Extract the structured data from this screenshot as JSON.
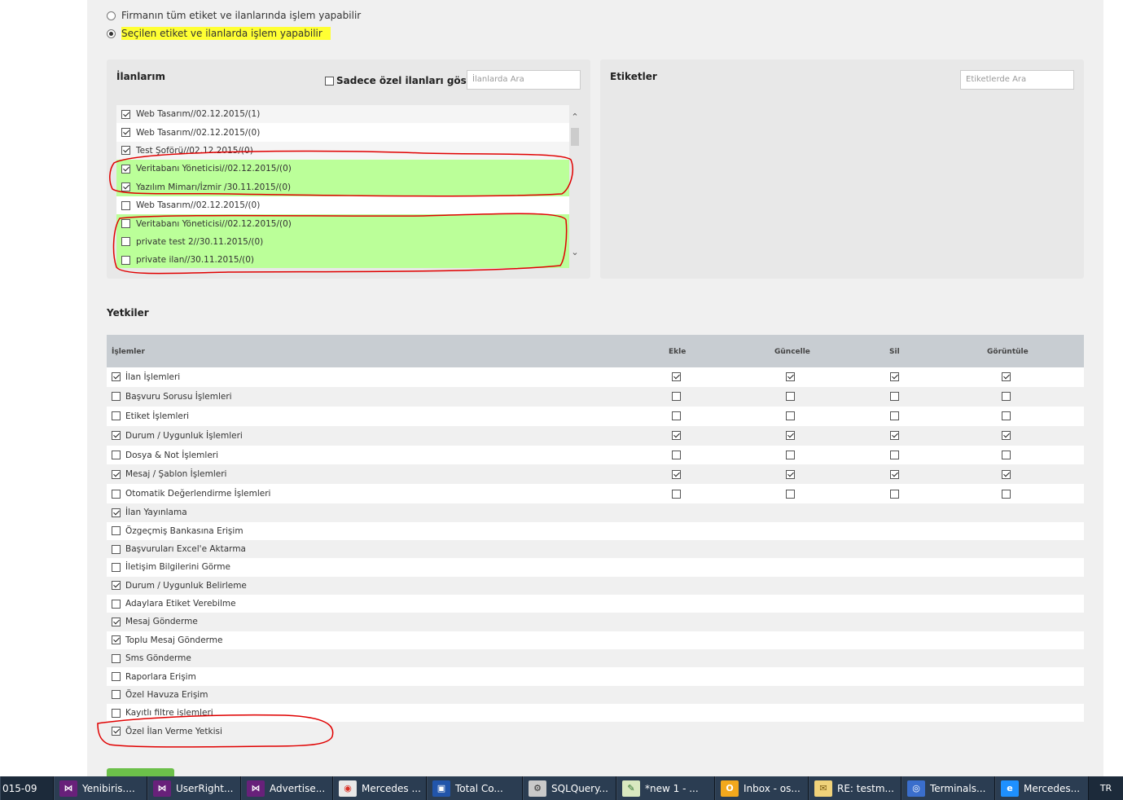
{
  "scope_options": [
    {
      "label": "Firmanın tüm etiket ve ilanlarında işlem yapabilir",
      "selected": false
    },
    {
      "label": "Seçilen etiket ve ilanlarda işlem yapabilir",
      "selected": true
    }
  ],
  "ilanlar_panel": {
    "title": "İlanlarım",
    "only_private_label": "Sadece özel ilanları göster",
    "only_private_checked": false,
    "search_placeholder": "İlanlarda Ara",
    "items": [
      {
        "label": "Web Tasarım//02.12.2015/(1)",
        "checked": true,
        "highlight": false
      },
      {
        "label": "Web Tasarım//02.12.2015/(0)",
        "checked": true,
        "highlight": false
      },
      {
        "label": "Test Şoförü//02.12.2015/(0)",
        "checked": true,
        "highlight": false
      },
      {
        "label": "Veritabanı Yöneticisi//02.12.2015/(0)",
        "checked": true,
        "highlight": true
      },
      {
        "label": "Yazılım Mimarı/İzmir /30.11.2015/(0)",
        "checked": true,
        "highlight": true
      },
      {
        "label": "Web Tasarım//02.12.2015/(0)",
        "checked": false,
        "highlight": false
      },
      {
        "label": "Veritabanı Yöneticisi//02.12.2015/(0)",
        "checked": false,
        "highlight": true
      },
      {
        "label": "private test 2//30.11.2015/(0)",
        "checked": false,
        "highlight": true
      },
      {
        "label": "private ilan//30.11.2015/(0)",
        "checked": false,
        "highlight": true
      }
    ]
  },
  "etiketler_panel": {
    "title": "Etiketler",
    "search_placeholder": "Etiketlerde Ara"
  },
  "yetkiler": {
    "title": "Yetkiler",
    "columns": [
      "İşlemler",
      "Ekle",
      "Güncelle",
      "Sil",
      "Görüntüle"
    ],
    "rows": [
      {
        "label": "İlan İşlemleri",
        "checked": true,
        "perms": [
          true,
          true,
          true,
          true
        ]
      },
      {
        "label": "Başvuru Sorusu İşlemleri",
        "checked": false,
        "perms": [
          false,
          false,
          false,
          false
        ]
      },
      {
        "label": "Etiket İşlemleri",
        "checked": false,
        "perms": [
          false,
          false,
          false,
          false
        ]
      },
      {
        "label": "Durum / Uygunluk İşlemleri",
        "checked": true,
        "perms": [
          true,
          true,
          true,
          true
        ]
      },
      {
        "label": "Dosya & Not İşlemleri",
        "checked": false,
        "perms": [
          false,
          false,
          false,
          false
        ]
      },
      {
        "label": "Mesaj / Şablon İşlemleri",
        "checked": true,
        "perms": [
          true,
          true,
          true,
          true
        ]
      },
      {
        "label": "Otomatik Değerlendirme İşlemleri",
        "checked": false,
        "perms": [
          false,
          false,
          false,
          false
        ]
      },
      {
        "label": "İlan Yayınlama",
        "checked": true
      },
      {
        "label": "Özgeçmiş Bankasına Erişim",
        "checked": false
      },
      {
        "label": "Başvuruları Excel'e Aktarma",
        "checked": false
      },
      {
        "label": "İletişim Bilgilerini Görme",
        "checked": false
      },
      {
        "label": "Durum / Uygunluk Belirleme",
        "checked": true
      },
      {
        "label": "Adaylara Etiket Verebilme",
        "checked": false
      },
      {
        "label": "Mesaj Gönderme",
        "checked": true
      },
      {
        "label": "Toplu Mesaj Gönderme",
        "checked": true
      },
      {
        "label": "Sms Gönderme",
        "checked": false
      },
      {
        "label": "Raporlara Erişim",
        "checked": false
      },
      {
        "label": "Özel Havuza Erişim",
        "checked": false
      },
      {
        "label": "Kayıtlı filtre işlemleri",
        "checked": false
      },
      {
        "label": "Özel İlan Verme Yetkisi",
        "checked": true
      }
    ]
  },
  "taskbar": {
    "clock_fragment": "015-09",
    "language": "TR",
    "items": [
      {
        "label": "Yenibiris....",
        "icon": "visual-studio-icon"
      },
      {
        "label": "UserRight...",
        "icon": "visual-studio-icon"
      },
      {
        "label": "Advertise...",
        "icon": "visual-studio-icon"
      },
      {
        "label": "Mercedes ...",
        "icon": "chrome-icon"
      },
      {
        "label": "Total Co...",
        "icon": "floppy-icon"
      },
      {
        "label": "SQLQuery...",
        "icon": "sql-icon"
      },
      {
        "label": "*new 1 - ...",
        "icon": "notepad-icon"
      },
      {
        "label": "Inbox - os...",
        "icon": "outlook-icon"
      },
      {
        "label": "RE: testm...",
        "icon": "mail-icon"
      },
      {
        "label": "Terminals...",
        "icon": "terminals-icon"
      },
      {
        "label": "Mercedes...",
        "icon": "ie-icon"
      }
    ]
  },
  "colors": {
    "highlight_green": "#bbff99",
    "annotation_red": "#e00000",
    "marker_yellow": "#ffff33"
  }
}
